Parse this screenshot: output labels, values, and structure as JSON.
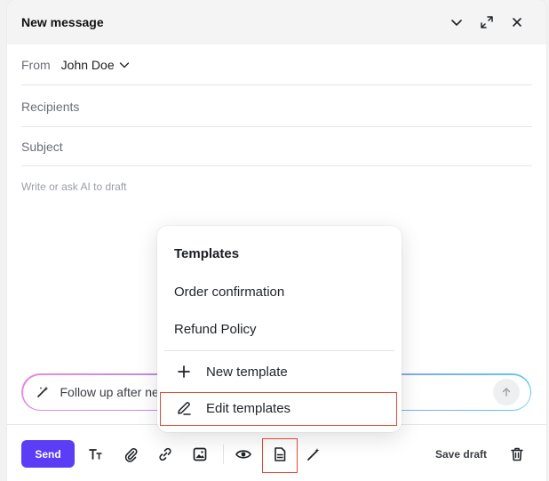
{
  "header": {
    "title": "New message"
  },
  "compose": {
    "from_label": "From",
    "from_name": "John Doe",
    "recipients_placeholder": "Recipients",
    "subject_placeholder": "Subject",
    "body_placeholder": "Write or ask AI to draft"
  },
  "ai_prompt": {
    "value": "Follow up after ne"
  },
  "toolbar": {
    "send_label": "Send",
    "save_draft_label": "Save draft"
  },
  "templates_menu": {
    "title": "Templates",
    "items": [
      "Order confirmation",
      "Refund Policy"
    ],
    "new_template_label": "New template",
    "edit_templates_label": "Edit templates"
  },
  "colors": {
    "accent": "#5b3df5",
    "highlight": "#e24b35"
  }
}
